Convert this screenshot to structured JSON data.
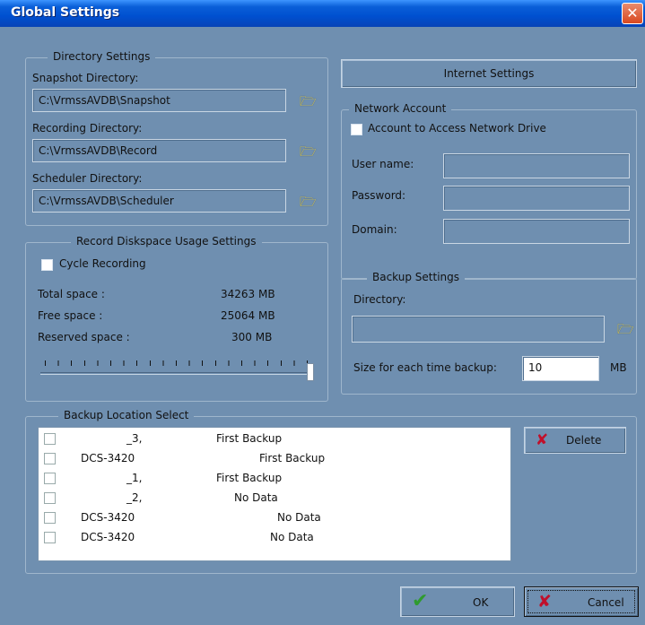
{
  "window": {
    "title": "Global Settings",
    "close_glyph": "✕"
  },
  "directory": {
    "group_title": "Directory Settings",
    "snapshot_label": "Snapshot Directory:",
    "snapshot_value": "C:\\VrmssAVDB\\Snapshot",
    "recording_label": "Recording Directory:",
    "recording_value": "C:\\VrmssAVDB\\Record",
    "scheduler_label": "Scheduler Directory:",
    "scheduler_value": "C:\\VrmssAVDB\\Scheduler"
  },
  "diskspace": {
    "group_title": "Record Diskspace Usage Settings",
    "cycle_label": "Cycle Recording",
    "total_label": "Total space :",
    "total_value": "34263 MB",
    "free_label": "Free space :",
    "free_value": "25064 MB",
    "reserved_label": "Reserved space :",
    "reserved_value": "300 MB",
    "slider_level": 1.0
  },
  "internet": {
    "button_label": "Internet Settings"
  },
  "network": {
    "group_title": "Network Account",
    "access_label": "Account to Access Network Drive",
    "username_label": "User name:",
    "password_label": "Password:",
    "domain_label": "Domain:",
    "username_value": "",
    "password_value": "",
    "domain_value": ""
  },
  "backup": {
    "group_title": "Backup Settings",
    "directory_label": "Directory:",
    "directory_value": "",
    "size_label": "Size for each time backup:",
    "size_value": "10",
    "size_unit": "MB"
  },
  "location": {
    "group_title": "Backup Location Select",
    "delete_label": "Delete",
    "rows": [
      {
        "device": "_3,",
        "status": "First Backup"
      },
      {
        "device": "DCS-3420",
        "status": "First Backup"
      },
      {
        "device": "_1,",
        "status": "First Backup"
      },
      {
        "device": "_2,",
        "status": "No Data"
      },
      {
        "device": "DCS-3420",
        "status": "No Data"
      },
      {
        "device": "DCS-3420",
        "status": "No Data"
      }
    ]
  },
  "footer": {
    "ok_label": "OK",
    "cancel_label": "Cancel"
  },
  "colors": {
    "title_bar": "#0a5fd8",
    "client_bg": "#6f8fb0",
    "ok_check": "#2f9b2f",
    "delete_x": "#c0102b"
  }
}
